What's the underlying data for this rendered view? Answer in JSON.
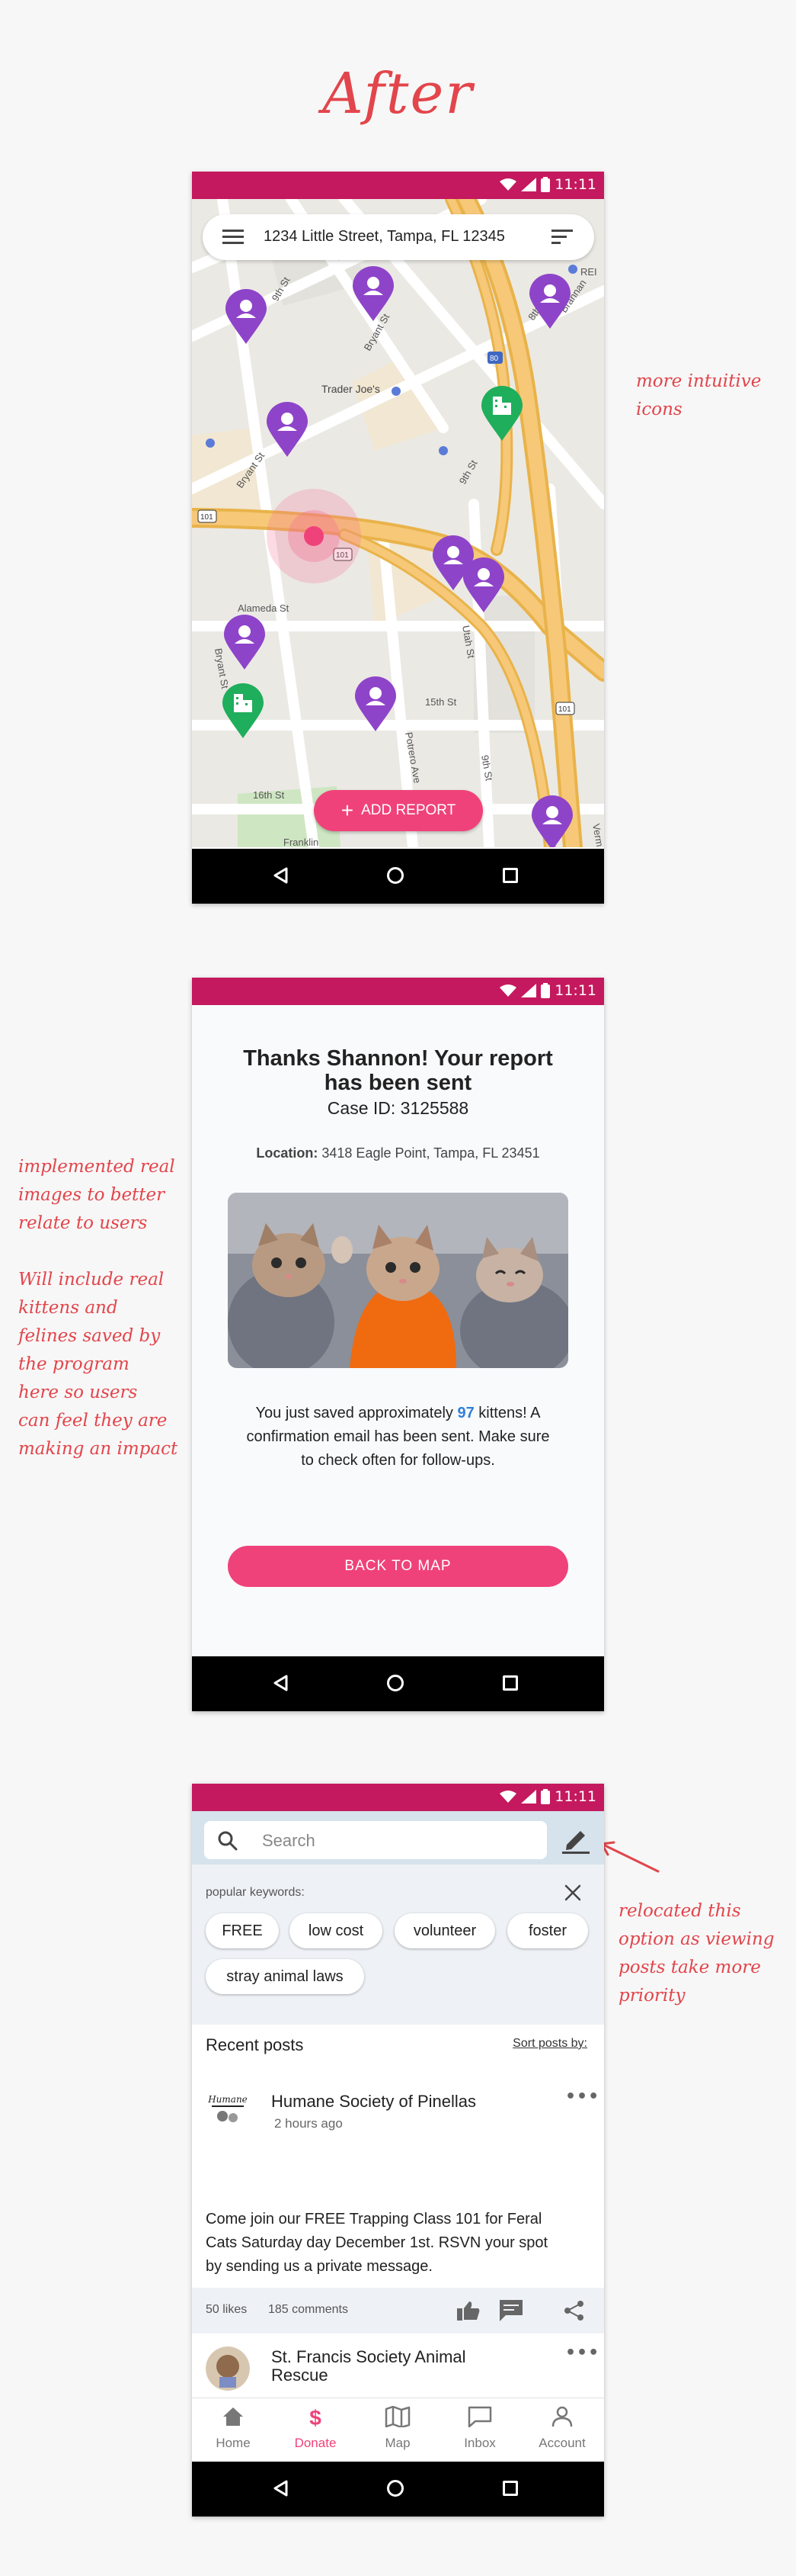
{
  "page_title": "After",
  "status": {
    "time": "11:11"
  },
  "notes": {
    "map_note": [
      "more intuitive",
      "icons"
    ],
    "images_note": [
      "implemented real",
      "images to better",
      "relate to users",
      "",
      "Will include real",
      "kittens and",
      "felines saved by",
      "the program",
      "here so users",
      "can feel they are",
      "making an impact"
    ],
    "relocate_note": [
      "relocated this",
      "option as viewing",
      "posts take more",
      "priority"
    ]
  },
  "map_screen": {
    "address": "1234 Little Street, Tampa, FL 12345",
    "add_report_label": "ADD REPORT",
    "map_labels": {
      "ninth_st_a": "9th St",
      "ninth_st_b": "9th St",
      "ninth_st_c": "9th St",
      "eighth_st": "8th St",
      "bryant_st_a": "Bryant St",
      "bryant_st_b": "Bryant St",
      "bryant_st_c": "Bryant St",
      "brannan": "Brannan",
      "trader_joes": "Trader Joe's",
      "rei": "REI",
      "hwy_80": "80",
      "hwy_101_a": "101",
      "hwy_101_b": "101",
      "hwy_101_c": "101",
      "alameda_st": "Alameda St",
      "utah_st": "Utah St",
      "fifteenth_st": "15th St",
      "potrero_ave": "Potrero Ave",
      "sixteenth_st": "16th St",
      "franklin": "Franklin",
      "vermont": "Verm"
    }
  },
  "thanks_screen": {
    "title_line1": "Thanks Shannon! Your report",
    "title_line2": "has been sent",
    "case_id": "Case ID: 3125588",
    "location_label": "Location:",
    "location_value": "3418 Eagle Point, Tampa, FL 23451",
    "saved_line1_pre": "You just saved approximately ",
    "saved_count": "97",
    "saved_line1_post": " kittens! A",
    "saved_line2": "confirmation email has been sent. Make sure",
    "saved_line3": "to check often for follow-ups.",
    "back_button": "BACK TO MAP"
  },
  "feed_screen": {
    "search_placeholder": "Search",
    "keywords_label": "popular keywords:",
    "keywords": [
      "FREE",
      "low cost",
      "volunteer",
      "foster",
      "stray animal laws"
    ],
    "recent_posts_label": "Recent posts",
    "sort_label": "Sort posts by:",
    "posts": [
      {
        "org": "Humane Society of Pinellas",
        "time": "2 hours ago",
        "logo_text": "Humane",
        "body_line1": "Come join our FREE Trapping Class 101 for Feral",
        "body_line2": "Cats Saturday day December 1st. RSVN your spot",
        "body_line3": "by sending us a private message.",
        "likes": "50 likes",
        "comments": "185 comments"
      },
      {
        "org_line1": "St. Francis Society Animal",
        "org_line2": "Rescue"
      }
    ],
    "tabs": [
      {
        "label": "Home",
        "icon": "home-icon"
      },
      {
        "label": "Donate",
        "icon": "dollar-icon"
      },
      {
        "label": "Map",
        "icon": "map-icon"
      },
      {
        "label": "Inbox",
        "icon": "inbox-icon"
      },
      {
        "label": "Account",
        "icon": "account-icon"
      }
    ],
    "active_tab": "Donate"
  },
  "colors": {
    "status_bar": "#c4195e",
    "accent_pink": "#f0427a",
    "pin_purple": "#8e44c9",
    "pin_green": "#1fae5b",
    "note_red": "#e2454b",
    "count_blue": "#2f7fd8"
  }
}
